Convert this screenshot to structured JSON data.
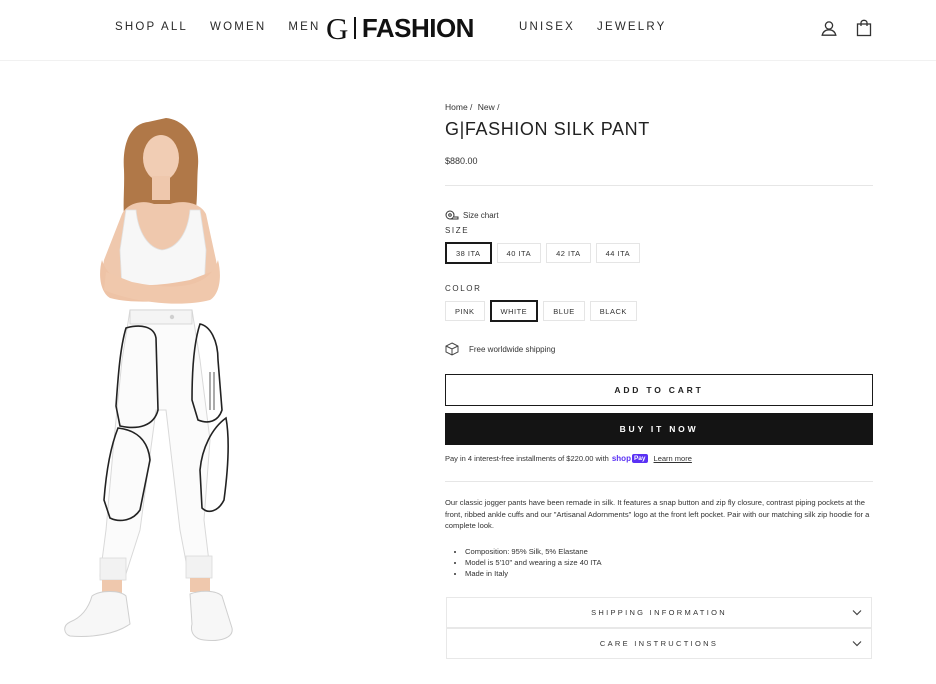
{
  "header": {
    "nav_left": [
      "SHOP ALL",
      "WOMEN",
      "MEN"
    ],
    "logo_g": "G",
    "logo_text": "FASHION",
    "nav_right": [
      "UNISEX",
      "JEWELRY"
    ],
    "icons": [
      "user-icon",
      "shopping-bag-icon"
    ]
  },
  "product": {
    "breadcrumb": [
      "Home /",
      "New /"
    ],
    "title": "G|FASHION SILK PANT",
    "price": "$880.00",
    "size_chart": "Size chart",
    "size_label": "SIZE",
    "sizes": [
      "38 ITA",
      "40 ITA",
      "42 ITA",
      "44 ITA"
    ],
    "selected_size": "38 ITA",
    "color_label": "COLOR",
    "colors": [
      "PINK",
      "WHITE",
      "BLUE",
      "BLACK"
    ],
    "selected_color": "WHITE",
    "shipping_note": "Free worldwide shipping",
    "add_to_cart": "ADD TO CART",
    "buy_now": "BUY IT NOW",
    "installments_text": "Pay in 4 interest-free installments of $220.00 with",
    "shop_pay_brand": "shop",
    "shop_pay_badge": "Pay",
    "learn_more": "Learn more",
    "description": "Our classic jogger pants have been remade in silk. It features a snap button and zip fly closure, contrast piping pockets at the front, ribbed ankle cuffs and our \"Artisanal Adornments\" logo at the front left pocket. Pair with our matching silk zip hoodie for a complete look.",
    "details": [
      "Composition: 95% Silk, 5% Elastane",
      "Model is 5'10\" and wearing a size 40 ITA",
      "Made in Italy"
    ],
    "accordions": [
      "SHIPPING INFORMATION",
      "CARE INSTRUCTIONS"
    ]
  },
  "colors": {
    "button_dark": "#141414",
    "shop_pay": "#5a31f4",
    "border": "#e5e5e5"
  }
}
